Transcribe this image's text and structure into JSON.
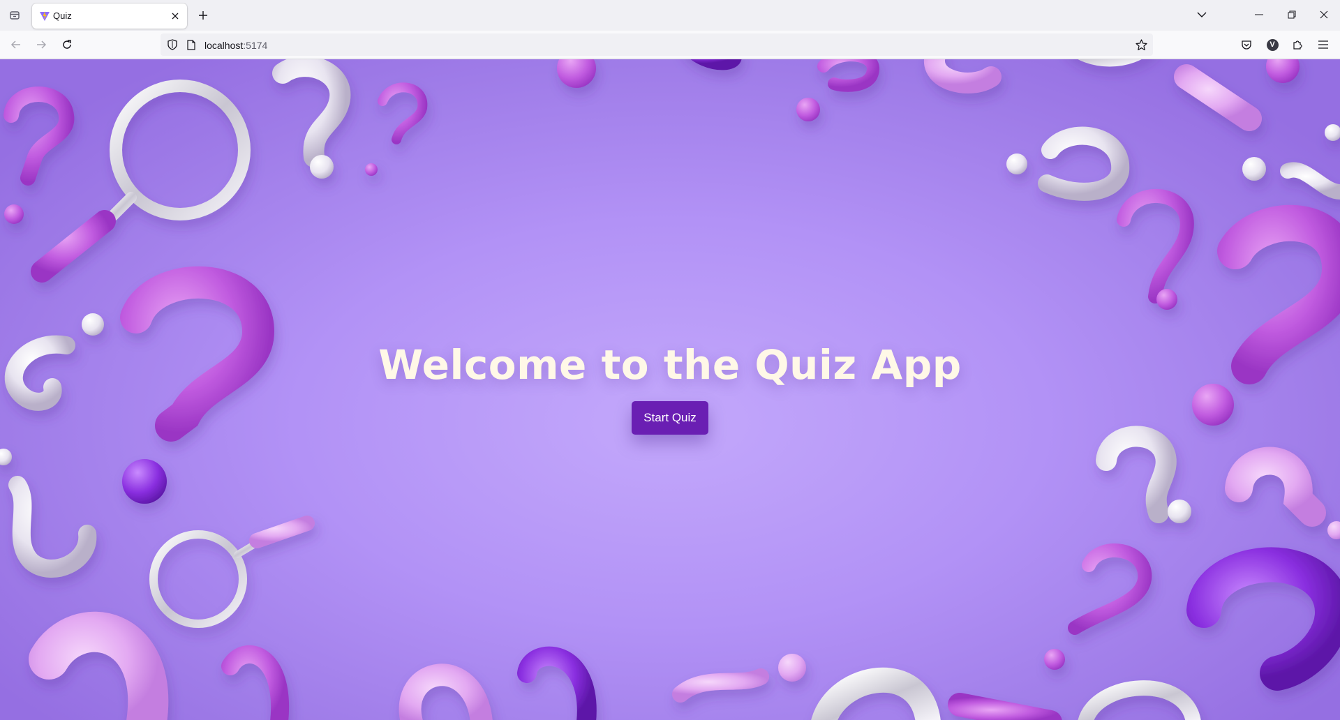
{
  "browser": {
    "tab": {
      "title": "Quiz"
    },
    "url": {
      "host": "localhost",
      "port": ":5174"
    },
    "profile_initial": "V"
  },
  "page": {
    "heading": "Welcome to the Quiz App",
    "start_button_label": "Start Quiz"
  },
  "colors": {
    "background_center": "#c3a8fb",
    "background_edge": "#956fe2",
    "heading": "#fff8e7",
    "button": "#6a1fb3"
  }
}
